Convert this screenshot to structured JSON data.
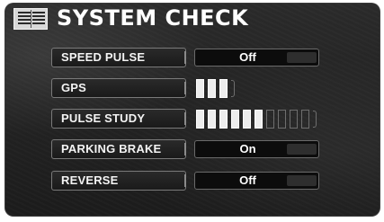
{
  "header": {
    "title": "SYSTEM CHECK",
    "icon": "list-icon"
  },
  "rows": [
    {
      "label": "SPEED PULSE",
      "value": "Off"
    },
    {
      "label": "GPS",
      "level": 3,
      "max": 3
    },
    {
      "label": "PULSE STUDY",
      "level": 6,
      "max": 10
    },
    {
      "label": "PARKING BRAKE",
      "value": "On"
    },
    {
      "label": "REVERSE",
      "value": "Off"
    }
  ],
  "colors": {
    "background": "#222222",
    "text": "#ffffff",
    "segment_on": "#ededed",
    "segment_off": "#6e6e6e"
  }
}
